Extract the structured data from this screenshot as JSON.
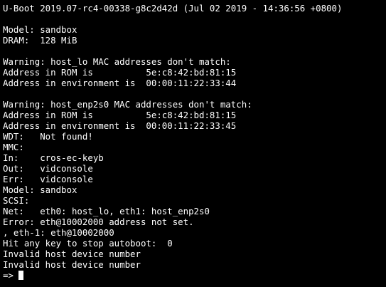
{
  "terminal": {
    "lines": [
      "U-Boot 2019.07-rc4-00338-g8c2d42d (Jul 02 2019 - 14:36:56 +0800)",
      "",
      "Model: sandbox",
      "DRAM:  128 MiB",
      "",
      "Warning: host_lo MAC addresses don't match:",
      "Address in ROM is          5e:c8:42:bd:81:15",
      "Address in environment is  00:00:11:22:33:44",
      "",
      "Warning: host_enp2s0 MAC addresses don't match:",
      "Address in ROM is          5e:c8:42:bd:81:15",
      "Address in environment is  00:00:11:22:33:45",
      "WDT:   Not found!",
      "MMC:",
      "In:    cros-ec-keyb",
      "Out:   vidconsole",
      "Err:   vidconsole",
      "Model: sandbox",
      "SCSI:",
      "Net:   eth0: host_lo, eth1: host_enp2s0",
      "Error: eth@10002000 address not set.",
      ", eth-1: eth@10002000",
      "Hit any key to stop autoboot:  0",
      "Invalid host device number",
      "Invalid host device number"
    ],
    "prompt": "=> ",
    "colors": {
      "background": "#000000",
      "foreground": "#ffffff"
    }
  }
}
